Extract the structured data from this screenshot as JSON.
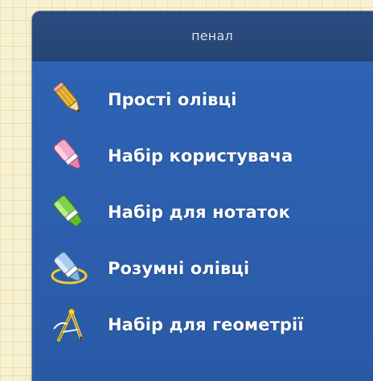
{
  "panel": {
    "title": "пенал",
    "items": [
      {
        "label": "Прості олівці",
        "icon": "pencil-icon"
      },
      {
        "label": "Набір користувача",
        "icon": "pink-marker-icon"
      },
      {
        "label": "Набір для нотаток",
        "icon": "highlighter-icon"
      },
      {
        "label": "Розумні олівці",
        "icon": "smart-pencil-icon"
      },
      {
        "label": "Набір для геометрії",
        "icon": "compass-icon"
      }
    ]
  },
  "colors": {
    "background": "#f7f1cf",
    "panel": "#2d61b1",
    "header": "#2a4a7e",
    "text": "#ffffff"
  }
}
